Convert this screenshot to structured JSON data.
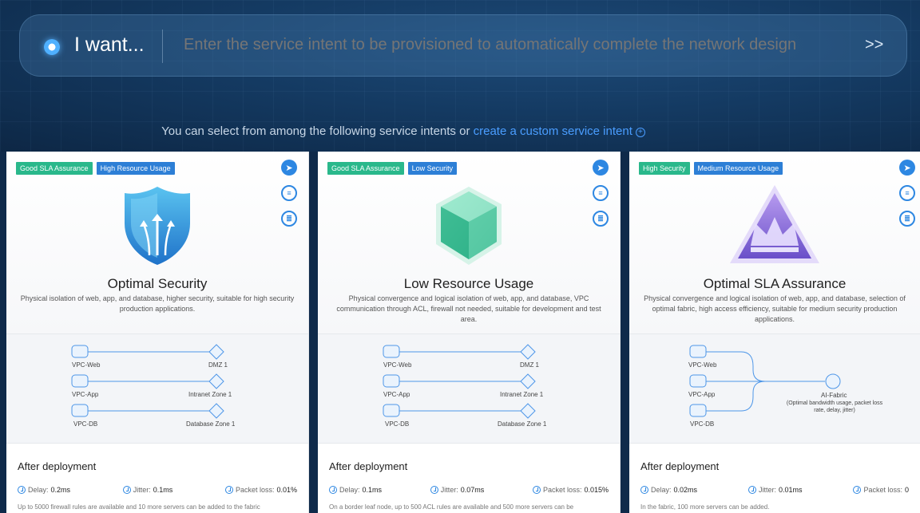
{
  "intent": {
    "prefix": "I want...",
    "placeholder": "Enter the service intent to be provisioned to automatically complete the network design",
    "go_symbol": ">>"
  },
  "subtitle": {
    "text": "You can select from among the following service intents or ",
    "link": "create a custom service intent",
    "plus": "+"
  },
  "colors": {
    "tag_green": "#2ab88b",
    "tag_blue": "#2d7fd6",
    "accent": "#2d87e2"
  },
  "cards": [
    {
      "tags": [
        "Good SLA Assurance",
        "High Resource Usage"
      ],
      "emblem_icon": "shield-arrows-icon",
      "title": "Optimal Security",
      "description": "Physical isolation of web, app, and database, higher security, suitable for high security production applications.",
      "diagram": {
        "left": [
          "VPC-Web",
          "VPC-App",
          "VPC-DB"
        ],
        "right": [
          "DMZ 1",
          "Intranet Zone 1",
          "Database Zone 1"
        ]
      },
      "after_label": "After deployment",
      "metrics": {
        "delay_label": "Delay:",
        "delay": "0.2ms",
        "jitter_label": "Jitter:",
        "jitter": "0.1ms",
        "loss_label": "Packet loss:",
        "loss": "0.01%"
      },
      "footnote": "Up to 5000 firewall rules are available and 10 more servers can be added to the fabric"
    },
    {
      "tags": [
        "Good SLA Assurance",
        "Low Security"
      ],
      "emblem_icon": "hexagon-shape-icon",
      "title": "Low Resource Usage",
      "description": "Physical convergence and logical isolation of web, app, and database, VPC communication through ACL, firewall not needed, suitable for development and test area.",
      "diagram": {
        "left": [
          "VPC-Web",
          "VPC-App",
          "VPC-DB"
        ],
        "right": [
          "DMZ 1",
          "Intranet Zone 1",
          "Database Zone 1"
        ]
      },
      "after_label": "After deployment",
      "metrics": {
        "delay_label": "Delay:",
        "delay": "0.1ms",
        "jitter_label": "Jitter:",
        "jitter": "0.07ms",
        "loss_label": "Packet loss:",
        "loss": "0.015%"
      },
      "footnote": "On a border leaf node, up to 500 ACL rules are available and 500 more servers can be"
    },
    {
      "tags": [
        "High Security",
        "Medium Resource Usage"
      ],
      "emblem_icon": "crown-triangle-icon",
      "title": "Optimal SLA Assurance",
      "description": "Physical convergence and logical isolation of web, app, and database, selection of optimal fabric, high access efficiency, suitable for medium security production applications.",
      "diagram": {
        "left": [
          "VPC-Web",
          "VPC-App",
          "VPC-DB"
        ],
        "right": [
          "AI-Fabric"
        ],
        "right_note": "(Optimal bandwidth usage, packet loss rate, delay, jitter)"
      },
      "after_label": "After deployment",
      "metrics": {
        "delay_label": "Delay:",
        "delay": "0.02ms",
        "jitter_label": "Jitter:",
        "jitter": "0.01ms",
        "loss_label": "Packet loss:",
        "loss": "0"
      },
      "footnote": "In the fabric, 100 more servers can be added."
    }
  ]
}
